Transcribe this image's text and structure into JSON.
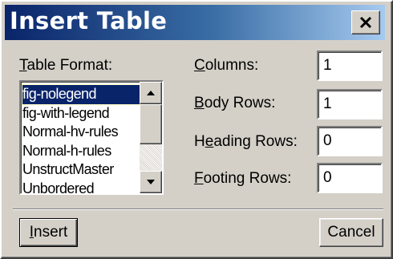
{
  "window": {
    "title": "Insert Table",
    "close_symbol": "close-icon"
  },
  "table_format": {
    "label_first": "T",
    "label_rest": "able Format:",
    "items": [
      "fig-nolegend",
      "fig-with-legend",
      "Normal-hv-rules",
      "Normal-h-rules",
      "UnstructMaster",
      "Unbordered"
    ],
    "selected": "fig-nolegend"
  },
  "columns": {
    "label_first": "C",
    "label_rest": "olumns:",
    "value": "1"
  },
  "body_rows": {
    "label_first": "B",
    "label_rest": "ody Rows:",
    "value": "1"
  },
  "heading_rows": {
    "label_pre": "H",
    "label_u": "e",
    "label_rest": "ading Rows:",
    "value": "0"
  },
  "footing_rows": {
    "label_first": "F",
    "label_rest": "ooting Rows:",
    "value": "0"
  },
  "buttons": {
    "insert_first": "I",
    "insert_rest": "nsert",
    "cancel": "Cancel"
  },
  "colors": {
    "title_gradient_start": "#0a246a",
    "title_gradient_end": "#a6caf0",
    "face": "#d4d0c8",
    "selection": "#0a246a"
  }
}
